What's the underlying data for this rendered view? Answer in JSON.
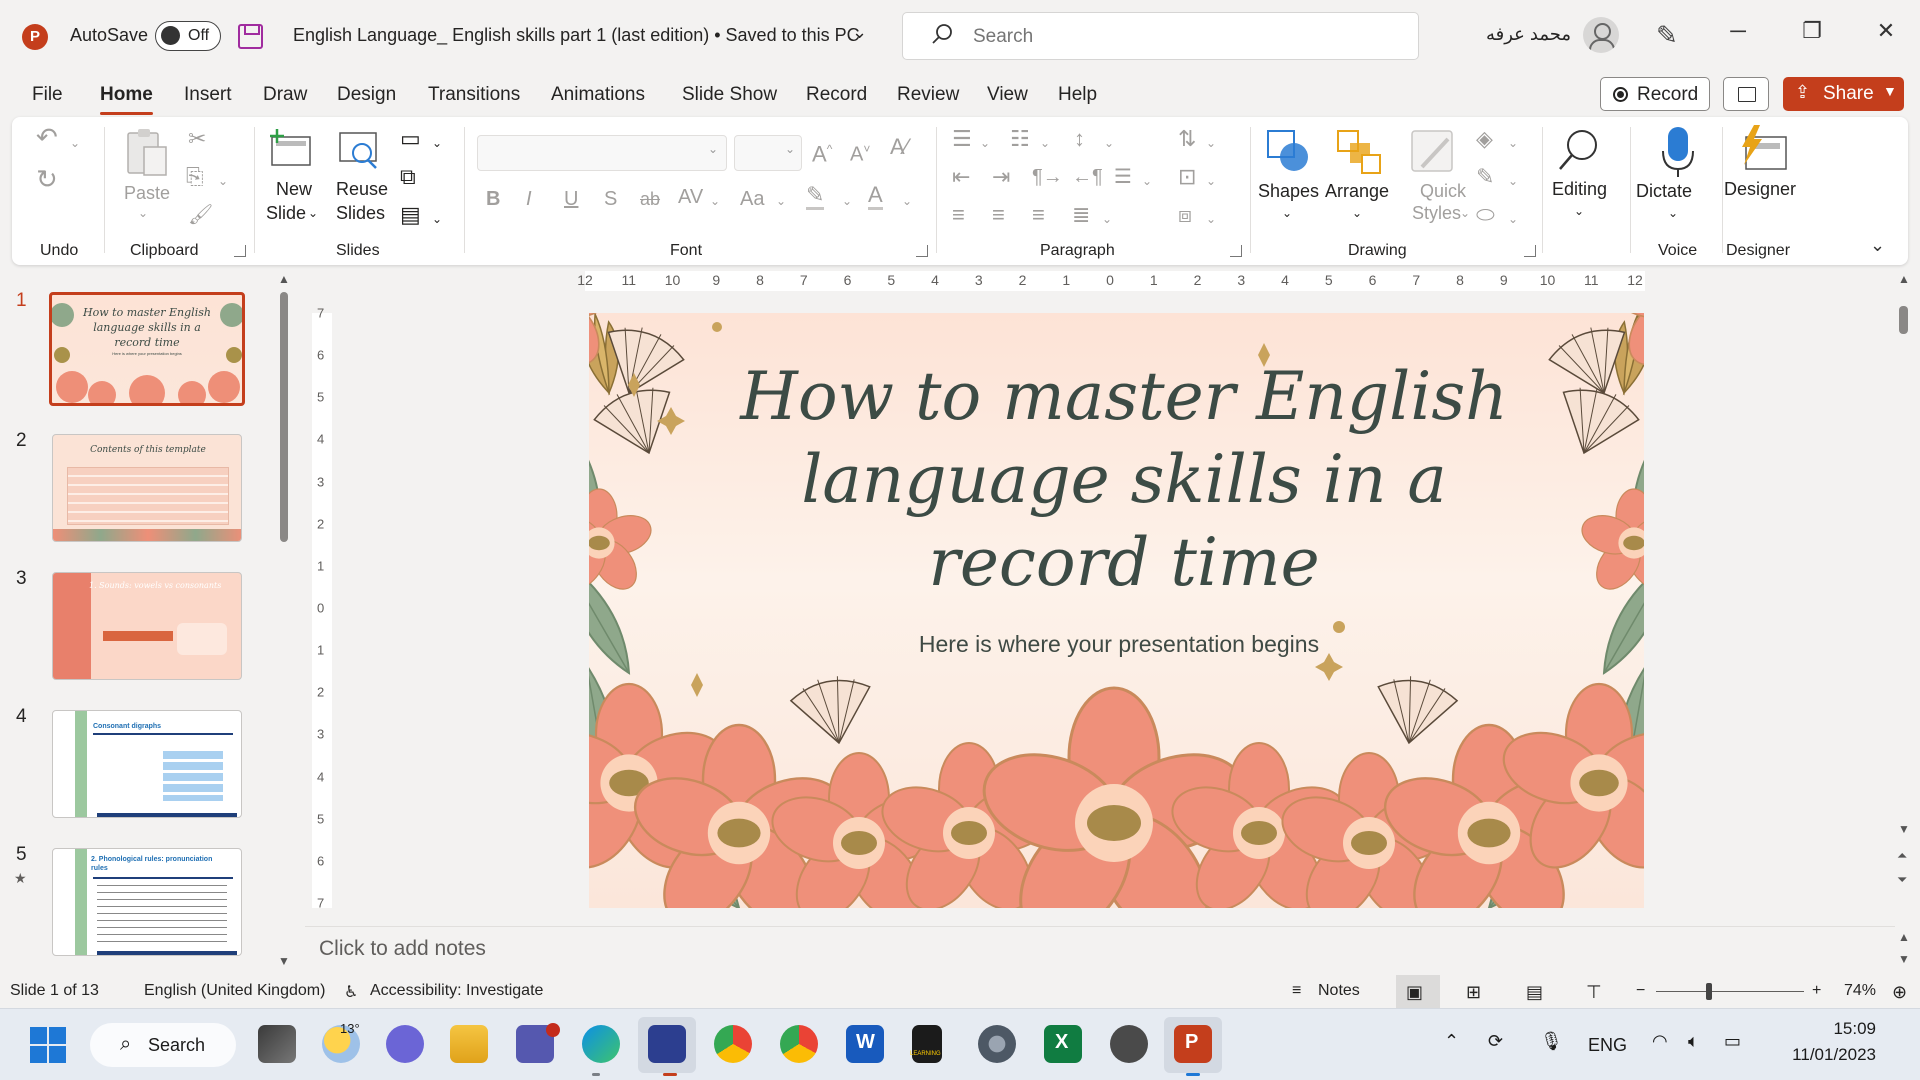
{
  "titlebar": {
    "app_logo": "P",
    "autosave_label": "AutoSave",
    "autosave_state": "Off",
    "document_title": "English Language_ English skills part 1 (last edition) • Saved to this PC",
    "search_placeholder": "Search",
    "user_name": "محمد عرفه"
  },
  "menu": {
    "tabs": [
      "File",
      "Home",
      "Insert",
      "Draw",
      "Design",
      "Transitions",
      "Animations",
      "Slide Show",
      "Record",
      "Review",
      "View",
      "Help"
    ],
    "active_tab": "Home",
    "record_label": "Record",
    "share_label": "Share"
  },
  "ribbon": {
    "groups": {
      "undo": "Undo",
      "clipboard": "Clipboard",
      "slides": "Slides",
      "font": "Font",
      "paragraph": "Paragraph",
      "drawing": "Drawing",
      "voice": "Voice",
      "designer": "Designer"
    },
    "buttons": {
      "paste": "Paste",
      "new_slide_1": "New",
      "new_slide_2": "Slide",
      "reuse_1": "Reuse",
      "reuse_2": "Slides",
      "shapes": "Shapes",
      "arrange": "Arrange",
      "quick_styles_1": "Quick",
      "quick_styles_2": "Styles",
      "editing": "Editing",
      "dictate": "Dictate",
      "designer": "Designer"
    },
    "font_buttons": [
      "B",
      "I",
      "U",
      "S",
      "ab",
      "AV",
      "Aa"
    ]
  },
  "thumbnails": [
    {
      "number": "1",
      "title": "How to master English language skills in a record time",
      "subtitle": "Here is where your presentation begins"
    },
    {
      "number": "2",
      "title": "Contents of this template"
    },
    {
      "number": "3",
      "title": "1. Sounds: vowels vs consonants"
    },
    {
      "number": "4",
      "title": "Consonant digraphs"
    },
    {
      "number": "5",
      "title": "2. Phonological rules: pronunciation rules"
    }
  ],
  "slide": {
    "title": "How to master English language skills in a record time",
    "subtitle": "Here is where your presentation begins"
  },
  "ruler": {
    "h_ticks": [
      "12",
      "11",
      "10",
      "9",
      "8",
      "7",
      "6",
      "5",
      "4",
      "3",
      "2",
      "1",
      "0",
      "1",
      "2",
      "3",
      "4",
      "5",
      "6",
      "7",
      "8",
      "9",
      "10",
      "11",
      "12"
    ],
    "v_ticks": [
      "7",
      "6",
      "5",
      "4",
      "3",
      "2",
      "1",
      "0",
      "1",
      "2",
      "3",
      "4",
      "5",
      "6",
      "7"
    ]
  },
  "notes_placeholder": "Click to add notes",
  "status": {
    "slide_counter": "Slide 1 of 13",
    "language": "English (United Kingdom)",
    "accessibility": "Accessibility: Investigate",
    "notes": "Notes",
    "zoom": "74%"
  },
  "taskbar": {
    "weather": "13°",
    "search": "Search",
    "lang": "ENG",
    "time": "15:09",
    "date": "11/01/2023",
    "word_letter": "W",
    "excel_letter": "X",
    "ppt_letter": "P",
    "learning_label": "LEARNING"
  },
  "colors": {
    "accent": "#c43e1c",
    "slide_title": "#3c4b45",
    "petal": "#ee8f78"
  }
}
